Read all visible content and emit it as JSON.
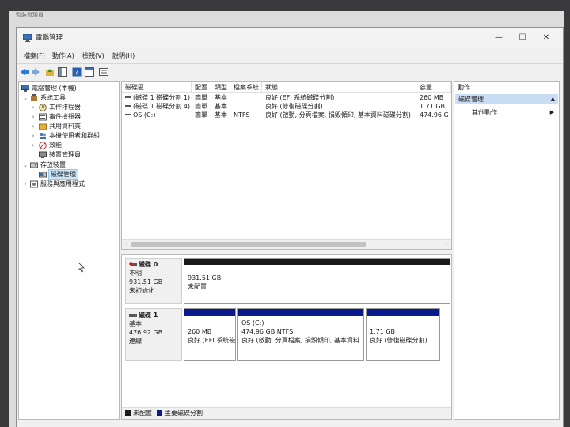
{
  "window": {
    "behind_title": "監裝發現員",
    "title": "電腦管理"
  },
  "menu": [
    "檔案(F)",
    "動作(A)",
    "檢視(V)",
    "說明(H)"
  ],
  "tree": {
    "root": "電腦管理 (本機)",
    "system_tools": "系統工具",
    "task_scheduler": "工作排程器",
    "event_viewer": "事件檢視器",
    "shared_folders": "共用資料夾",
    "local_users": "本機使用者和群組",
    "performance": "效能",
    "device_manager": "裝置管理員",
    "storage": "存放裝置",
    "disk_management": "磁碟管理",
    "services": "服務與應用程式"
  },
  "volume_list": {
    "columns": [
      "磁碟區",
      "配置",
      "類型",
      "檔案系統",
      "狀態",
      "容量"
    ],
    "rows": [
      {
        "volume": "(磁碟 1 磁碟分割 1)",
        "layout": "簡單",
        "type": "基本",
        "fs": "",
        "status": "良好 (EFI 系統磁碟分割)",
        "capacity": "260 MB"
      },
      {
        "volume": "(磁碟 1 磁碟分割 4)",
        "layout": "簡單",
        "type": "基本",
        "fs": "",
        "status": "良好 (修復磁碟分割)",
        "capacity": "1.71 GB"
      },
      {
        "volume": "OS (C:)",
        "layout": "簡單",
        "type": "基本",
        "fs": "NTFS",
        "status": "良好 (啟動, 分頁檔案, 損毀傾印, 基本資料磁碟分割)",
        "capacity": "474.96 G"
      }
    ]
  },
  "disks": [
    {
      "name": "磁碟 0",
      "type": "不明",
      "size": "931.51 GB",
      "state": "未初始化",
      "partitions": [
        {
          "label": "",
          "size": "931.51 GB",
          "status": "未配置"
        }
      ]
    },
    {
      "name": "磁碟 1",
      "type": "基本",
      "size": "476.92 GB",
      "state": "連線",
      "partitions": [
        {
          "label": "",
          "size": "260 MB",
          "status": "良好 (EFI 系統磁"
        },
        {
          "label": "OS (C:)",
          "size": "474.96 GB NTFS",
          "status": "良好 (啟動, 分頁檔案, 損毀傾印, 基本資料"
        },
        {
          "label": "",
          "size": "1.71 GB",
          "status": "良好 (修復磁碟分割)"
        }
      ]
    }
  ],
  "legend": [
    "未配置",
    "主要磁碟分割"
  ],
  "actions": {
    "header": "動作",
    "section": "磁碟管理",
    "more": "其他動作"
  },
  "colors": {
    "unallocated": "#1a1a1a",
    "primary_partition": "#0a1a8c",
    "selection": "#cce4f7",
    "actions_section": "#c9def5"
  }
}
